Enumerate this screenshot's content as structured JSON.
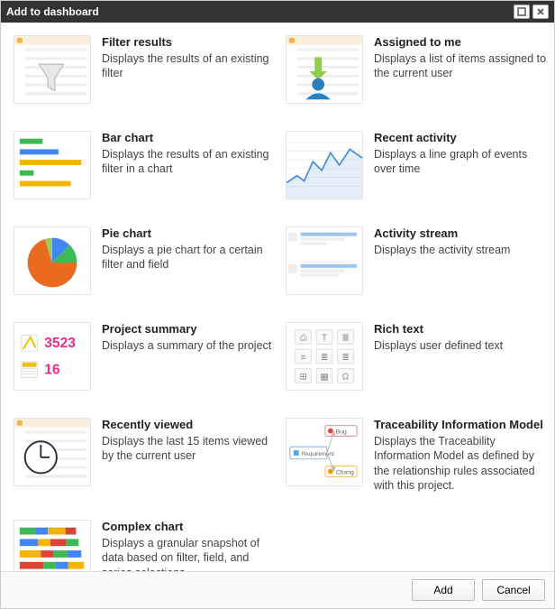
{
  "title": "Add to dashboard",
  "buttons": {
    "add": "Add",
    "cancel": "Cancel"
  },
  "gadgets": [
    {
      "icon": "funnel-icon",
      "name": "Filter results",
      "desc": "Displays the results of an existing filter"
    },
    {
      "icon": "assigned-icon",
      "name": "Assigned to me",
      "desc": "Displays a list of items assigned to the current user"
    },
    {
      "icon": "bar-chart-icon",
      "name": "Bar chart",
      "desc": "Displays the results of an existing filter in a chart"
    },
    {
      "icon": "line-chart-icon",
      "name": "Recent activity",
      "desc": "Displays a line graph of events over time"
    },
    {
      "icon": "pie-chart-icon",
      "name": "Pie chart",
      "desc": "Displays a pie chart for a certain filter and field"
    },
    {
      "icon": "activity-stream-icon",
      "name": "Activity stream",
      "desc": "Displays the activity stream"
    },
    {
      "icon": "project-summary-icon",
      "name": "Project summary",
      "desc": "Displays a summary of the project",
      "numbers": [
        "3523",
        "16"
      ]
    },
    {
      "icon": "rich-text-icon",
      "name": "Rich text",
      "desc": "Displays user defined text"
    },
    {
      "icon": "clock-icon",
      "name": "Recently viewed",
      "desc": "Displays the last 15 items viewed by the current user"
    },
    {
      "icon": "traceability-icon",
      "name": "Traceability Information Model",
      "desc": "Displays the Traceability Information Model as defined by the relationship rules associated with this project.",
      "nodes": [
        "Bug",
        "Requirement",
        "Chang"
      ]
    },
    {
      "icon": "complex-chart-icon",
      "name": "Complex chart",
      "desc": "Displays a granular snapshot of data based on filter, field, and series selections"
    }
  ]
}
